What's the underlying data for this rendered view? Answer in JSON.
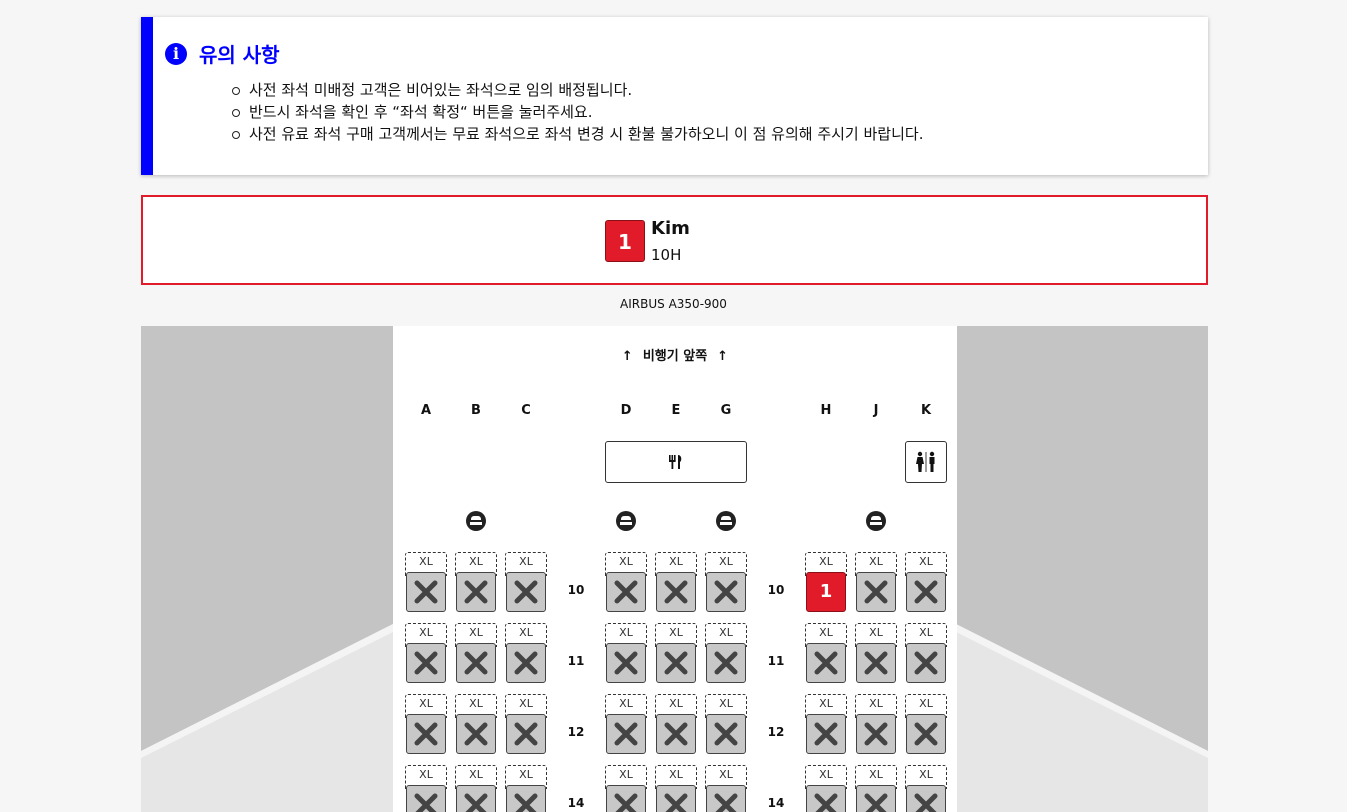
{
  "notice": {
    "title": "유의 사항",
    "icon": "info-icon",
    "items": [
      "사전 좌석 미배정 고객은 비어있는 좌석으로 임의 배정됩니다.",
      "반드시 좌석을 확인 후 “좌석 확정“ 버튼을 눌러주세요.",
      "사전 유료 좌석 구매 고객께서는 무료 좌석으로 좌석 변경 시 환불 불가하오니 이 점 유의해 주시기 바랍니다."
    ]
  },
  "passenger": {
    "number": "1",
    "name": "Kim",
    "seat": "10H"
  },
  "aircraft": "AIRBUS A350-900",
  "cabin": {
    "front_label": "비행기 앞쪽",
    "columns": [
      "A",
      "B",
      "C",
      "D",
      "E",
      "G",
      "H",
      "J",
      "K"
    ],
    "xl_label": "XL",
    "rows": [
      "10",
      "11",
      "12",
      "14"
    ],
    "selected_seat_label": "1"
  },
  "colors": {
    "accent": "#0000ff",
    "selected": "#e11b29"
  }
}
